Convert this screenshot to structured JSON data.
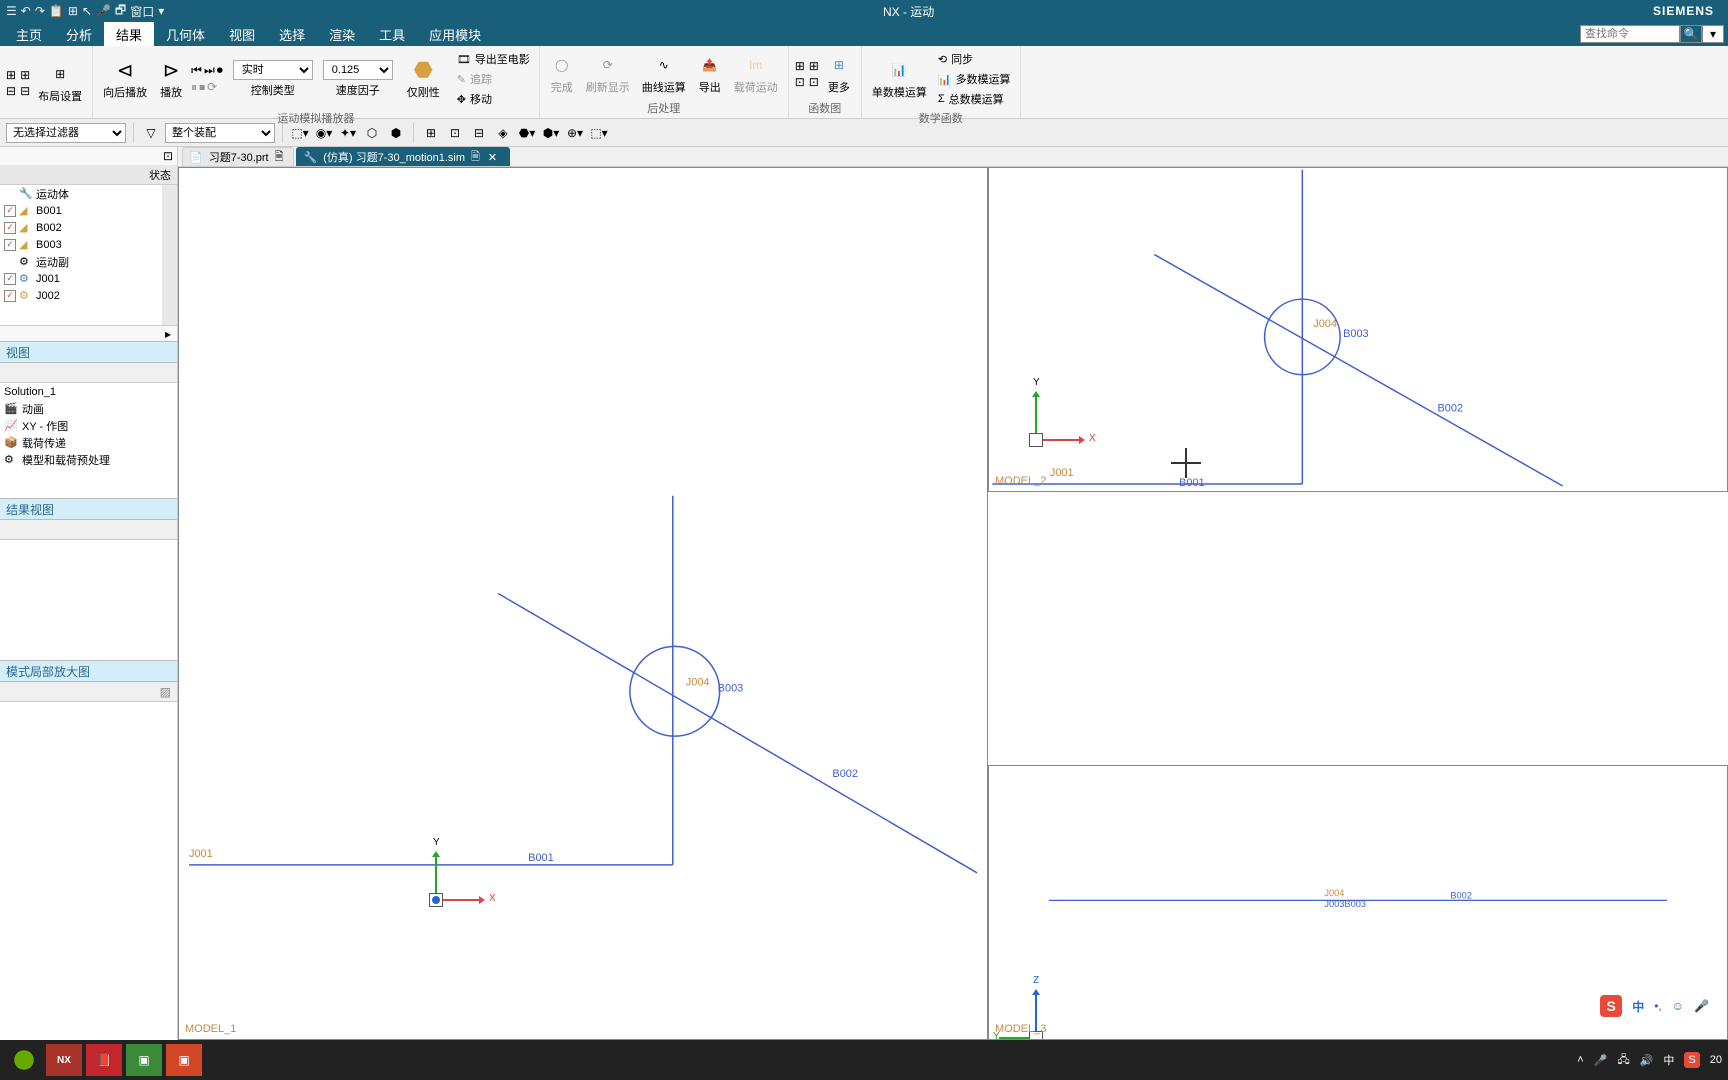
{
  "titlebar": {
    "app_title": "NX - 运动",
    "brand": "SIEMENS",
    "window_menu": "窗口"
  },
  "menubar": {
    "items": [
      "主页",
      "分析",
      "结果",
      "几何体",
      "视图",
      "选择",
      "渲染",
      "工具",
      "应用模块"
    ],
    "active_index": 2,
    "search_placeholder": "查找命令"
  },
  "ribbon": {
    "layout": {
      "label": "布局设置"
    },
    "playback": {
      "back": "向后播放",
      "play": "播放"
    },
    "control": {
      "type_label": "控制类型",
      "type_value": "实时",
      "speed_label": "速度因子",
      "speed_value": "0.125"
    },
    "animation_only": {
      "label": "仅刚性",
      "export_movie": "导出至电影",
      "trace": "追踪",
      "move": "移动"
    },
    "finish": "完成",
    "refresh": "刷新显示",
    "curve": "曲线运算",
    "export": "导出",
    "load_motion": "载荷运动",
    "more": "更多",
    "single_calc": "单数模运算",
    "sync": "同步",
    "multi_calc": "多数模运算",
    "total_calc": "总数模运算",
    "groups": {
      "sim_player": "运动模拟播放器",
      "post": "后处理",
      "func": "函数图",
      "math": "数学函数"
    }
  },
  "toolbar": {
    "filter_value": "无选择过滤器",
    "assembly_value": "整个装配"
  },
  "tabs": {
    "items": [
      {
        "label": "习题7-30.prt",
        "icon": "📄"
      },
      {
        "label": "(仿真) 习题7-30_motion1.sim",
        "icon": "🔧"
      }
    ],
    "active_index": 1
  },
  "tree": {
    "state_col": "状态",
    "bodies_label": "运动体",
    "joints_label": "运动副",
    "bodies": [
      "B001",
      "B002",
      "B003"
    ],
    "joints": [
      "J001",
      "J002"
    ]
  },
  "section_view": {
    "title": "视图"
  },
  "list": {
    "solution": "Solution_1",
    "items": [
      {
        "icon": "🎬",
        "label": "动画"
      },
      {
        "icon": "📈",
        "label": "XY - 作图"
      },
      {
        "icon": "📦",
        "label": "载荷传递"
      },
      {
        "icon": "⚙",
        "label": "模型和载荷预处理"
      }
    ]
  },
  "section_result": {
    "title": "结果视图"
  },
  "section_zoom": {
    "title": "模式局部放大图"
  },
  "viewports": {
    "model1": "MODEL_1",
    "model2": "MODEL_2",
    "model3": "MODEL_3",
    "labels": {
      "B001": "B001",
      "B002": "B002",
      "B003": "B003",
      "J001": "J001",
      "J004": "J004",
      "J003B003": "J003B003"
    },
    "axes": {
      "X": "X",
      "Y": "Y",
      "Z": "Z"
    }
  },
  "ime": {
    "lang": "中"
  },
  "taskbar": {
    "time": "20",
    "lang": "中"
  }
}
